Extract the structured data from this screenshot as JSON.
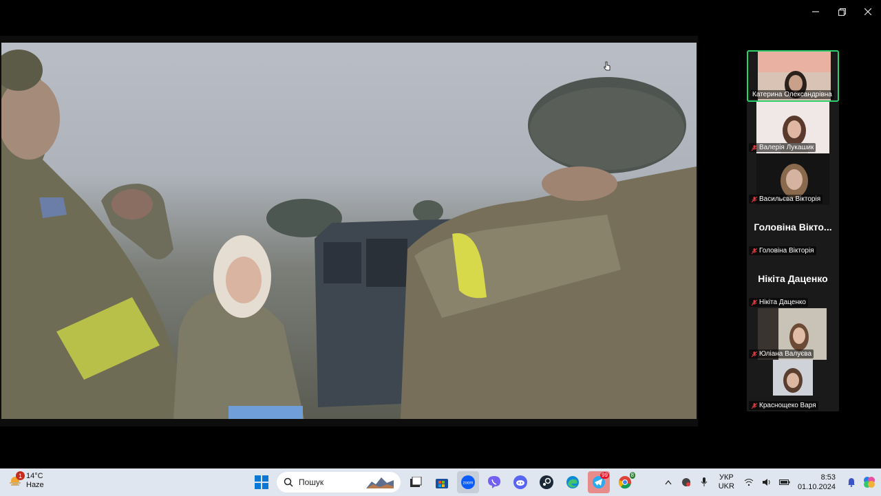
{
  "window": {
    "controls": [
      "minimize",
      "restore",
      "close"
    ]
  },
  "participants": [
    {
      "name": "Катерина Олександрівна",
      "video": true,
      "active_speaker": true,
      "muted": false
    },
    {
      "name": "Валерія Лукашик",
      "video": true,
      "active_speaker": false,
      "muted": true
    },
    {
      "name": "Васильєва Вікторія",
      "video": true,
      "active_speaker": false,
      "muted": true
    },
    {
      "name": "Головіна Вікторія",
      "display_name": "Головіна Вікто...",
      "video": false,
      "active_speaker": false,
      "muted": true
    },
    {
      "name": "Нікіта Даценко",
      "display_name": "Нікіта Даценко",
      "video": false,
      "active_speaker": false,
      "muted": true
    },
    {
      "name": "Юліана Валуєва",
      "video": true,
      "active_speaker": false,
      "muted": true
    },
    {
      "name": "Краснощеко Варя",
      "video": true,
      "active_speaker": false,
      "muted": true
    }
  ],
  "taskbar": {
    "weather": {
      "temp": "14°C",
      "condition": "Haze",
      "badge": "1"
    },
    "search_placeholder": "Пошук",
    "apps": [
      "windows-start",
      "file-explorer",
      "microsoft-store",
      "zoom",
      "viber",
      "discord",
      "steam",
      "edge",
      "telegram",
      "chrome"
    ],
    "telegram_badge": "99",
    "chrome_badge": "8",
    "language": {
      "line1": "УКР",
      "line2": "UKR"
    },
    "clock": {
      "time": "8:53",
      "date": "01.10.2024"
    }
  },
  "colors": {
    "active_speaker_border": "#2ed06e",
    "taskbar_bg": "#dfe6ef",
    "muted_icon": "#e0393e"
  }
}
